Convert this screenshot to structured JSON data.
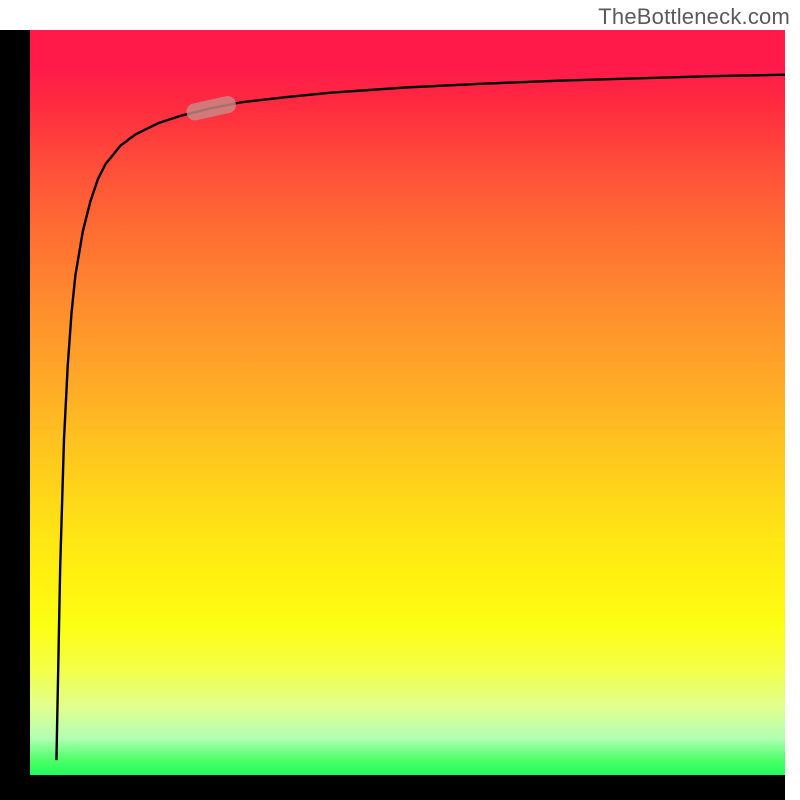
{
  "watermark": "TheBottleneck.com",
  "chart_data": {
    "type": "line",
    "title": "",
    "xlabel": "",
    "ylabel": "",
    "xlim": [
      0,
      100
    ],
    "ylim": [
      0,
      100
    ],
    "x": [
      3.5,
      4,
      4.5,
      5,
      5.5,
      6,
      7,
      8,
      9,
      10,
      12,
      14,
      17,
      20,
      24,
      28,
      34,
      40,
      50,
      60,
      70,
      80,
      90,
      100
    ],
    "values": [
      2,
      28,
      45,
      55,
      62,
      67,
      73,
      77,
      80,
      82,
      84.5,
      86,
      87.5,
      88.5,
      89.5,
      90.3,
      91,
      91.6,
      92.3,
      92.8,
      93.2,
      93.5,
      93.8,
      94
    ],
    "marker_point": {
      "x": 24,
      "y": 89.5
    },
    "background_gradient": {
      "top_color": "#ff1a4a",
      "bottom_color": "#1fff5c",
      "description": "red-yellow-green vertical gradient"
    },
    "curve_color": "#000000",
    "axes_color": "#000000"
  }
}
